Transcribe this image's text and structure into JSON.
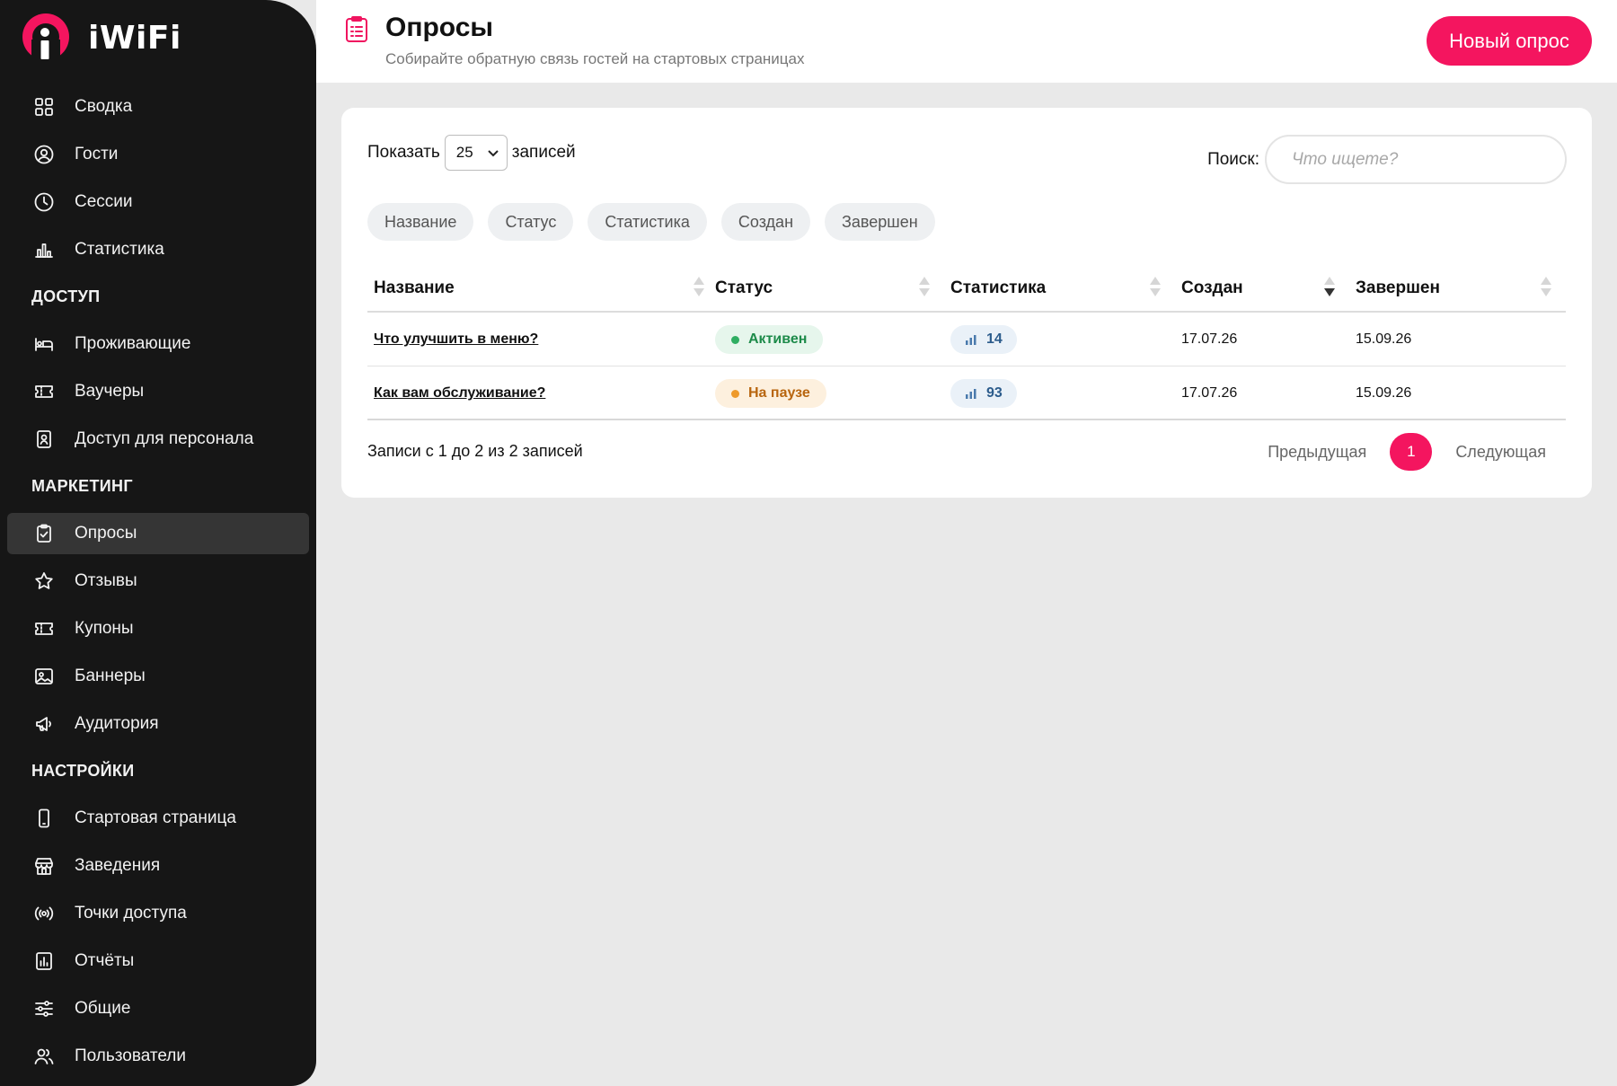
{
  "app": {
    "name": "iWiFi",
    "brand_color": "#f4155f"
  },
  "sidebar": {
    "items": [
      {
        "label": "Сводка",
        "icon": "dashboard-icon"
      },
      {
        "label": "Гости",
        "icon": "user-circle-icon"
      },
      {
        "label": "Сессии",
        "icon": "clock-icon"
      },
      {
        "label": "Статистика",
        "icon": "bar-chart-icon"
      }
    ],
    "access": {
      "title": "ДОСТУП",
      "items": [
        {
          "label": "Проживающие",
          "icon": "bed-icon"
        },
        {
          "label": "Ваучеры",
          "icon": "ticket-icon"
        },
        {
          "label": "Доступ для персонала",
          "icon": "badge-icon"
        }
      ]
    },
    "marketing": {
      "title": "МАРКЕТИНГ",
      "items": [
        {
          "label": "Опросы",
          "icon": "clipboard-icon",
          "active": true
        },
        {
          "label": "Отзывы",
          "icon": "star-icon"
        },
        {
          "label": "Купоны",
          "icon": "coupon-icon"
        },
        {
          "label": "Баннеры",
          "icon": "image-icon"
        },
        {
          "label": "Аудитория",
          "icon": "megaphone-icon"
        }
      ]
    },
    "settings": {
      "title": "НАСТРОЙКИ",
      "items": [
        {
          "label": "Стартовая страница",
          "icon": "phone-icon"
        },
        {
          "label": "Заведения",
          "icon": "store-icon"
        },
        {
          "label": "Точки доступа",
          "icon": "broadcast-icon"
        },
        {
          "label": "Отчёты",
          "icon": "report-icon"
        },
        {
          "label": "Общие",
          "icon": "sliders-icon"
        },
        {
          "label": "Пользователи",
          "icon": "users-icon"
        }
      ]
    }
  },
  "header": {
    "title": "Опросы",
    "subtitle": "Собирайте обратную связь гостей на стартовых страницах",
    "new_button": "Новый опрос"
  },
  "controls": {
    "show_label": "Показать",
    "page_size": "25",
    "records_label": "записей",
    "search_label": "Поиск:",
    "search_placeholder": "Что ищете?",
    "search_value": ""
  },
  "column_chips": [
    "Название",
    "Статус",
    "Статистика",
    "Создан",
    "Завершен"
  ],
  "table": {
    "columns": [
      "Название",
      "Статус",
      "Статистика",
      "Создан",
      "Завершен"
    ],
    "sorted_column": "Создан",
    "rows": [
      {
        "title": "Что улучшить в меню?",
        "status": "Активен",
        "status_kind": "active",
        "stat": "14",
        "created": "17.07.26",
        "finished": "15.09.26"
      },
      {
        "title": "Как вам обслуживание?",
        "status": "На паузе",
        "status_kind": "paused",
        "stat": "93",
        "created": "17.07.26",
        "finished": "15.09.26"
      }
    ]
  },
  "footer": {
    "info": "Записи с 1 до 2 из 2 записей",
    "prev": "Предыдущая",
    "current_page": "1",
    "next": "Следующая"
  }
}
